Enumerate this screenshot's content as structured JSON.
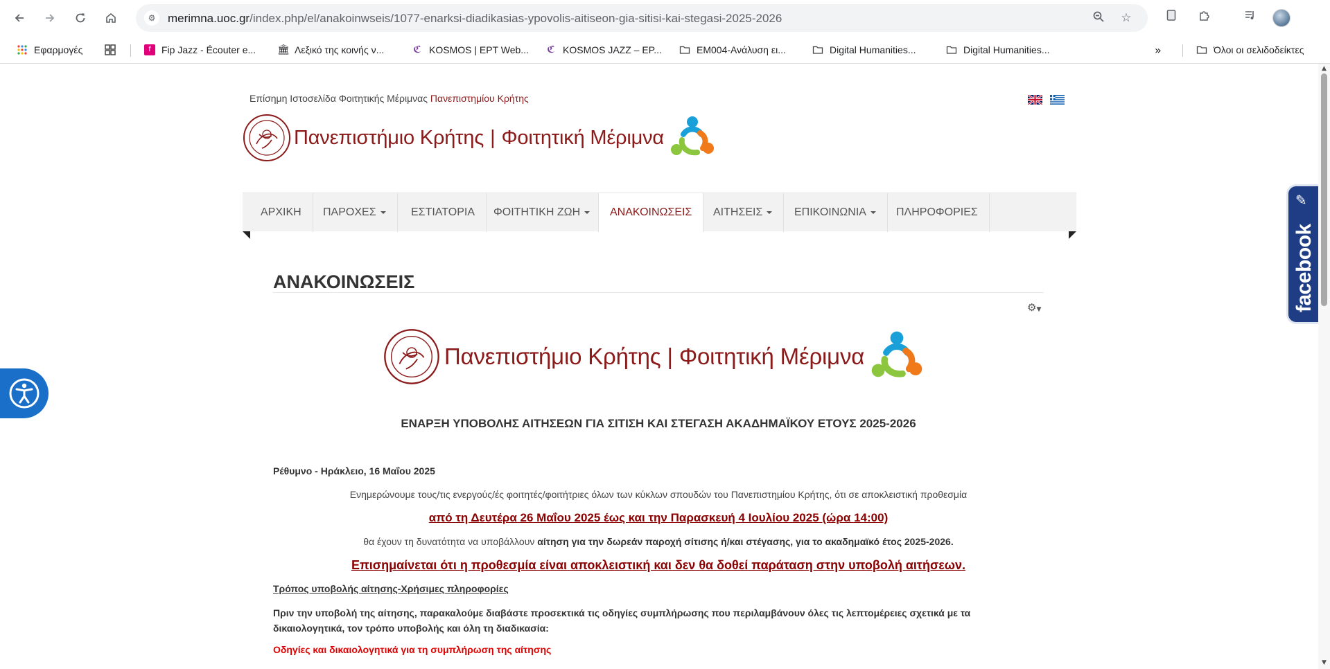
{
  "browser": {
    "url_host": "merimna.uoc.gr",
    "url_rest": "/index.php/el/anakoinwseis/1077-enarksi-diadikasias-ypovolis-aitiseon-gia-sitisi-kai-stegasi-2025-2026",
    "bookmarks": [
      {
        "label": "Εφαρμογές",
        "icon": "apps-grid-icon"
      },
      {
        "label": "Fip Jazz - Écouter e...",
        "icon": "fip-icon"
      },
      {
        "label": "Λεξικό της κοινής ν...",
        "icon": "museum-icon"
      },
      {
        "label": "KOSMOS | EPT Web...",
        "icon": "kosmos-icon"
      },
      {
        "label": "KOSMOS JAZZ – EP...",
        "icon": "kosmos-icon"
      },
      {
        "label": "EM004-Ανάλυση ει...",
        "icon": "folder-icon"
      },
      {
        "label": "Digital Humanities...",
        "icon": "folder-icon"
      },
      {
        "label": "Digital Humanities...",
        "icon": "folder-icon"
      }
    ],
    "all_bookmarks": "Όλοι οι σελιδοδείκτες"
  },
  "site": {
    "tagline_prefix": "Επίσημη Ιστοσελίδα Φοιτητικής Μέριμνας",
    "tagline_uni": "Πανεπιστημίου Κρήτης",
    "logo_uni": "Πανεπιστήμιο Κρήτης",
    "logo_bar": "|",
    "logo_service": "Φοιτητική Μέριμνα",
    "nav": [
      {
        "label": "ΑΡΧΙΚΗ",
        "dropdown": false,
        "active": false
      },
      {
        "label": "ΠΑΡΟΧΕΣ",
        "dropdown": true,
        "active": false
      },
      {
        "label": "ΕΣΤΙΑΤΟΡΙΑ",
        "dropdown": false,
        "active": false
      },
      {
        "label": "ΦΟΙΤΗΤΙΚΗ ΖΩΗ",
        "dropdown": true,
        "active": false
      },
      {
        "label": "ΑΝΑΚΟΙΝΩΣΕΙΣ",
        "dropdown": false,
        "active": true
      },
      {
        "label": "ΑΙΤΗΣΕΙΣ",
        "dropdown": true,
        "active": false
      },
      {
        "label": "ΕΠΙΚΟΙΝΩΝΙΑ",
        "dropdown": true,
        "active": false
      },
      {
        "label": "ΠΛΗΡΟΦΟΡΙΕΣ",
        "dropdown": false,
        "active": false
      }
    ]
  },
  "page": {
    "title": "ΑΝΑΚΟΙΝΩΣΕΙΣ",
    "headline": "ΕΝΑΡΞΗ ΥΠΟΒΟΛΗΣ ΑΙΤΗΣΕΩΝ ΓΙΑ ΣΙΤΙΣΗ ΚΑΙ ΣΤΕΓΑΣΗ ΑΚΑΔΗΜΑΪΚΟΥ ΕΤΟΥΣ 2025-2026",
    "dateline": "Ρέθυμνο - Ηράκλειο, 16 Μαΐου 2025",
    "para1": "Ενημερώνουμε τους/τις ενεργούς/ές φοιτητές/φοιτήτριες όλων των κύκλων σπουδών του Πανεπιστημίου Κρήτης, ότι σε αποκλειστική προθεσμία",
    "dates": "από τη Δευτέρα 26 Μαΐου 2025 έως και την Παρασκευή 4 Ιουλίου 2025 (ώρα 14:00)",
    "para2_prefix": "θα έχουν τη δυνατότητα να υποβάλλουν",
    "para2_bold": "αίτηση για την δωρεάν παροχή σίτισης ή/και στέγασης, για το ακαδημαϊκό έτος 2025-2026.",
    "deadline_note": "Επισημαίνεται ότι η προθεσμία είναι αποκλειστική και δεν θα δοθεί παράταση στην υποβολή αιτήσεων.",
    "howto_heading": "Τρόπος υποβολής αίτησης-Χρήσιμες πληροφορίες",
    "para3": "Πριν την υποβολή της αίτησης, παρακαλούμε διαβάστε προσεκτικά τις οδηγίες συμπλήρωσης που περιλαμβάνουν όλες τις λεπτομέρειες σχετικά με τα δικαιολογητικά, τον τρόπο υποβολής και όλη τη διαδικασία:",
    "instructions_link": "Οδηγίες και δικαιολογητικά για τη συμπλήρωση της αίτησης"
  },
  "widgets": {
    "facebook_label": "facebook"
  },
  "colors": {
    "brand_red": "#8b1a1a",
    "alert_red": "#e00000",
    "facebook_blue": "#1e3d85",
    "accessibility_blue": "#1a6fc9"
  }
}
